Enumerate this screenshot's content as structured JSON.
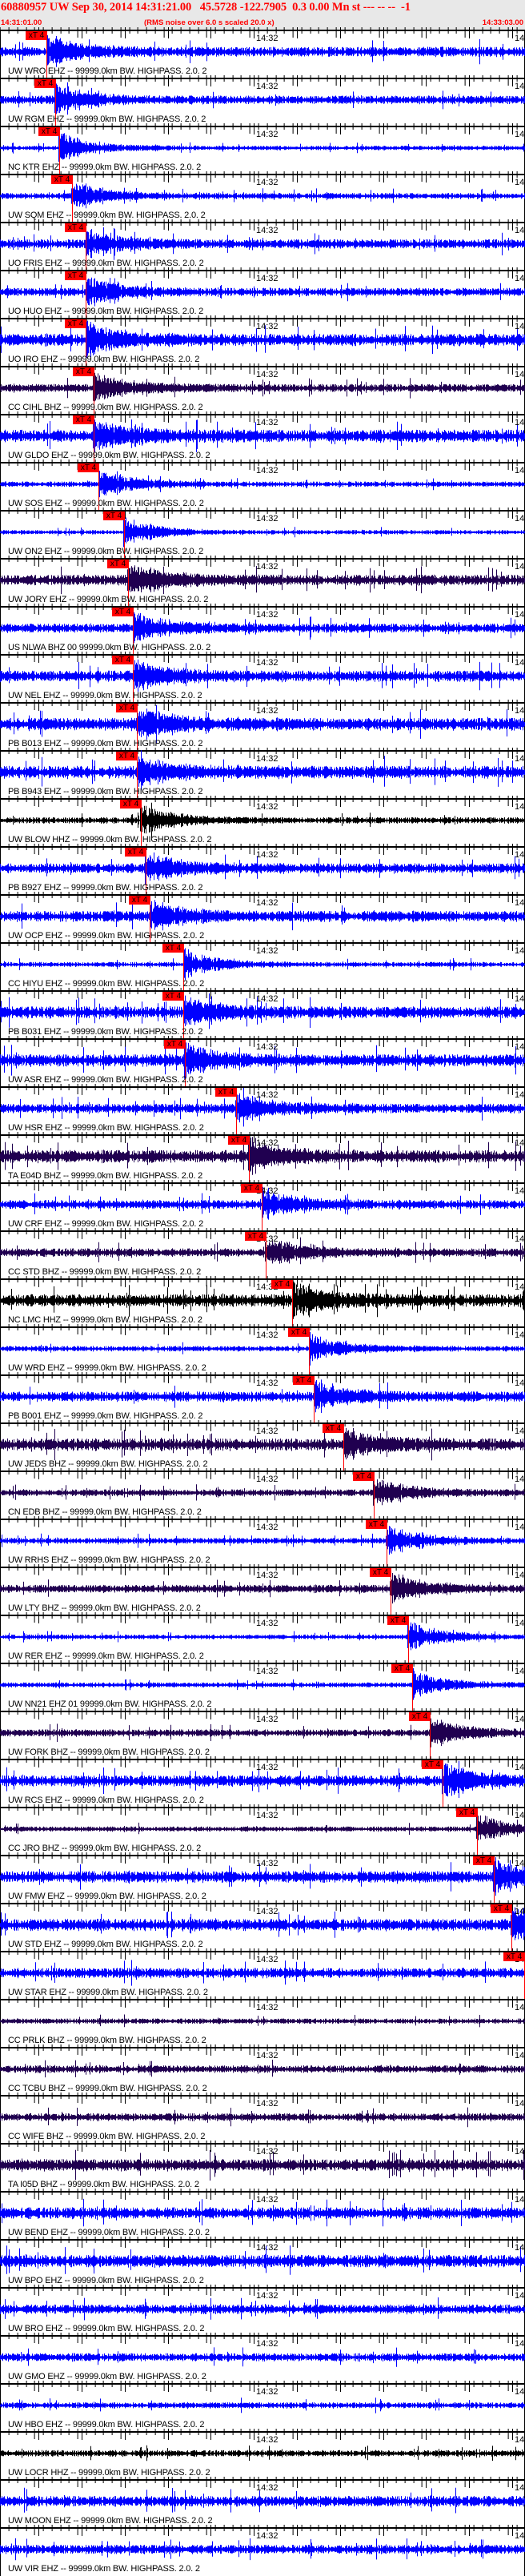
{
  "header": {
    "title": "60880957 UW Sep 30, 2014 14:31:21.00   45.5728 -122.7905  0.3 0.00 Mn st --- -- --  -1",
    "start_time": "14:31:01.00",
    "note": "(RMS noise over 6.0 s scaled 20.0 x)",
    "end_time": "14:33:03.00"
  },
  "axis": {
    "window_seconds": 122,
    "label_1432": "14:32",
    "label_1432_offset_s": 59,
    "label_1433": "14",
    "label_1433_offset_s": 119
  },
  "pick_label": "xT 4",
  "filter_suffix": " 99999.0km BW. HIGHPASS. 2.0. 2",
  "colors": {
    "blue": "#0000ff",
    "purple": "#200050",
    "black": "#000000",
    "pick": "#ff0000",
    "header_text": "#ff0000"
  },
  "traces": [
    {
      "label": "UW WRO EHZ --",
      "color": "blue",
      "pick_s": 11.0
    },
    {
      "label": "UW RGM EHZ --",
      "color": "blue",
      "pick_s": 13.0
    },
    {
      "label": "NC KTR EHZ --",
      "color": "blue",
      "pick_s": 13.9
    },
    {
      "label": "UW SQM EHZ --",
      "color": "blue",
      "pick_s": 16.9
    },
    {
      "label": "UO FRIS EHZ --",
      "color": "blue",
      "pick_s": 20.1
    },
    {
      "label": "UO HUO EHZ --",
      "color": "blue",
      "pick_s": 20.1
    },
    {
      "label": "UO IRO EHZ --",
      "color": "blue",
      "pick_s": 20.1
    },
    {
      "label": "CC CIHL BHZ --",
      "color": "purple",
      "pick_s": 21.9
    },
    {
      "label": "UW GLDO EHZ --",
      "color": "blue",
      "pick_s": 21.9
    },
    {
      "label": "UW SOS EHZ --",
      "color": "blue",
      "pick_s": 23.1
    },
    {
      "label": "UW ON2 EHZ --",
      "color": "blue",
      "pick_s": 29.0
    },
    {
      "label": "UW JORY EHZ --",
      "color": "purple",
      "pick_s": 29.9
    },
    {
      "label": "US NLWA BHZ 00",
      "color": "blue",
      "pick_s": 31.1
    },
    {
      "label": "UW NEL EHZ --",
      "color": "blue",
      "pick_s": 31.1
    },
    {
      "label": "PB B013 EHZ --",
      "color": "blue",
      "pick_s": 32.0
    },
    {
      "label": "PB B943 EHZ --",
      "color": "blue",
      "pick_s": 32.0
    },
    {
      "label": "UW BLOW HHZ --",
      "color": "black",
      "pick_s": 32.9
    },
    {
      "label": "PB B927 EHZ --",
      "color": "blue",
      "pick_s": 34.0
    },
    {
      "label": "UW OCP EHZ --",
      "color": "blue",
      "pick_s": 35.0
    },
    {
      "label": "CC HIYU EHZ --",
      "color": "blue",
      "pick_s": 42.8
    },
    {
      "label": "PB B031 EHZ --",
      "color": "blue",
      "pick_s": 42.8
    },
    {
      "label": "UW ASR EHZ --",
      "color": "blue",
      "pick_s": 43.1
    },
    {
      "label": "UW HSR EHZ --",
      "color": "blue",
      "pick_s": 55.0
    },
    {
      "label": "TA E04D BHZ --",
      "color": "purple",
      "pick_s": 58.0
    },
    {
      "label": "UW CRF EHZ --",
      "color": "blue",
      "pick_s": 61.0
    },
    {
      "label": "CC STD BHZ --",
      "color": "purple",
      "pick_s": 61.9
    },
    {
      "label": "NC LMC HHZ --",
      "color": "black",
      "pick_s": 68.1
    },
    {
      "label": "UW WRD EHZ --",
      "color": "blue",
      "pick_s": 72.0
    },
    {
      "label": "PB B001 EHZ --",
      "color": "blue",
      "pick_s": 73.1
    },
    {
      "label": "UW JEDS BHZ --",
      "color": "purple",
      "pick_s": 80.0
    },
    {
      "label": "CN EDB BHZ --",
      "color": "purple",
      "pick_s": 87.0
    },
    {
      "label": "UW RRHS EHZ --",
      "color": "blue",
      "pick_s": 90.0
    },
    {
      "label": "UW LTY BHZ --",
      "color": "purple",
      "pick_s": 90.9
    },
    {
      "label": "UW RER EHZ --",
      "color": "blue",
      "pick_s": 95.0
    },
    {
      "label": "UW NN21 EHZ 01",
      "color": "blue",
      "pick_s": 96.0
    },
    {
      "label": "UW FORK BHZ --",
      "color": "purple",
      "pick_s": 100.1
    },
    {
      "label": "UW RCS EHZ --",
      "color": "blue",
      "pick_s": 103.0
    },
    {
      "label": "CC JRO BHZ --",
      "color": "purple",
      "pick_s": 111.0
    },
    {
      "label": "UW FMW EHZ --",
      "color": "blue",
      "pick_s": 114.9
    },
    {
      "label": "UW STD EHZ --",
      "color": "blue",
      "pick_s": 119.0
    },
    {
      "label": "UW STAR EHZ --",
      "color": "blue",
      "pick_s": 122.0
    },
    {
      "label": "CC PRLK BHZ --",
      "color": "purple",
      "pick_s": null
    },
    {
      "label": "CC TCBU BHZ --",
      "color": "purple",
      "pick_s": null
    },
    {
      "label": "CC WIFE BHZ --",
      "color": "purple",
      "pick_s": null
    },
    {
      "label": "TA I05D BHZ --",
      "color": "purple",
      "pick_s": null
    },
    {
      "label": "UW BEND EHZ --",
      "color": "blue",
      "pick_s": null
    },
    {
      "label": "UW BPO EHZ --",
      "color": "blue",
      "pick_s": null
    },
    {
      "label": "UW BRO EHZ --",
      "color": "blue",
      "pick_s": null
    },
    {
      "label": "UW GMO EHZ --",
      "color": "blue",
      "pick_s": null
    },
    {
      "label": "UW HBO EHZ --",
      "color": "blue",
      "pick_s": null
    },
    {
      "label": "UW LOCR HHZ --",
      "color": "black",
      "pick_s": null
    },
    {
      "label": "UW MOON EHZ --",
      "color": "blue",
      "pick_s": null
    },
    {
      "label": "UW VIR EHZ --",
      "color": "blue",
      "pick_s": null
    }
  ]
}
